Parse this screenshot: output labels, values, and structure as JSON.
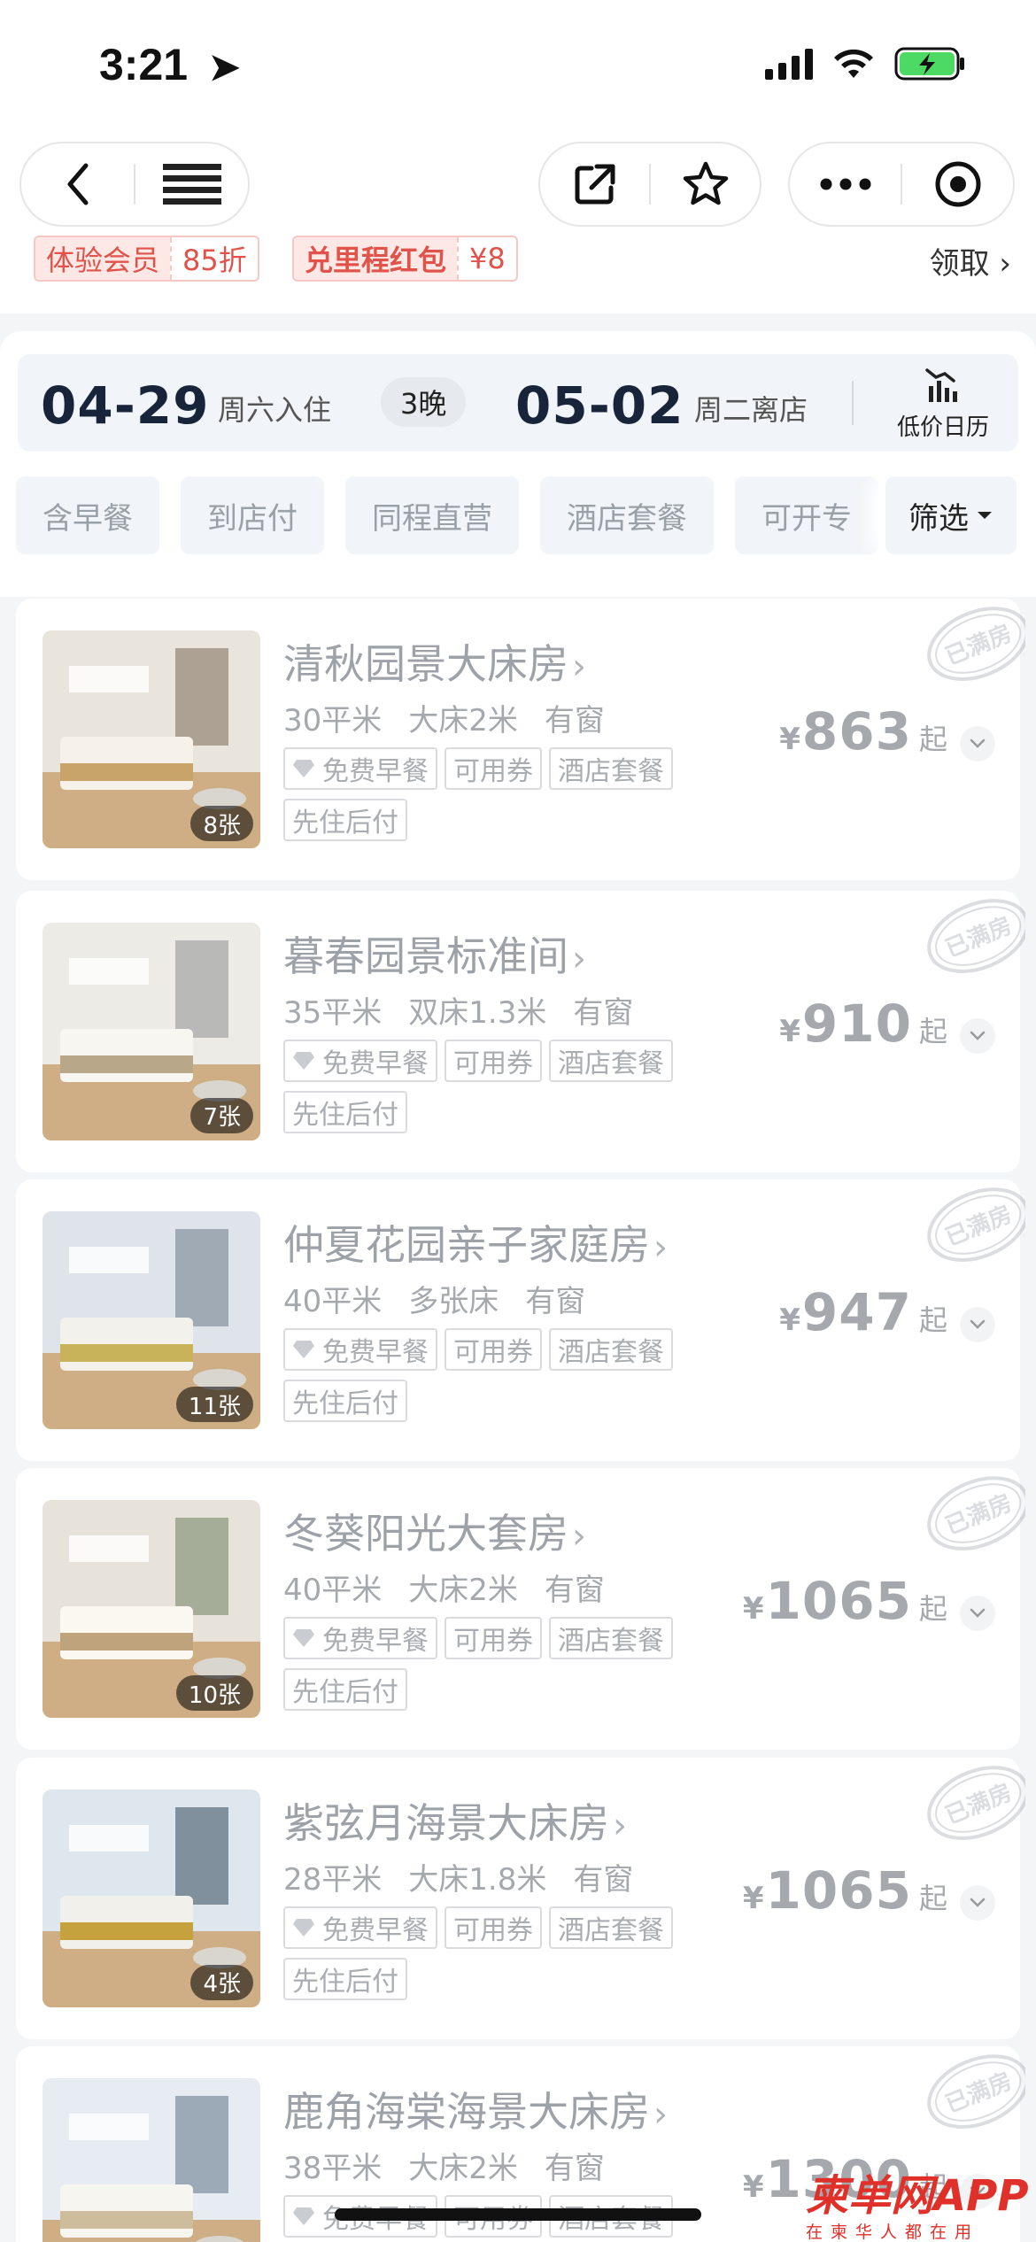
{
  "status_bar": {
    "time": "3:21"
  },
  "promo": {
    "tag1_left": "体验会员",
    "tag1_right": "85折",
    "tag2_left": "兑里程红包",
    "tag2_right": "¥8",
    "claim": "领取 ›"
  },
  "dates": {
    "checkin_date": "04-29",
    "checkin_label": "周六入住",
    "nights": "3晚",
    "checkout_date": "05-02",
    "checkout_label": "周二离店",
    "calendar_label": "低价日历"
  },
  "filters": {
    "chips": [
      "含早餐",
      "到店付",
      "同程直营",
      "酒店套餐",
      "可开专"
    ],
    "filter_button": "筛选"
  },
  "rooms": [
    {
      "name": "清秋园景大床房",
      "area": "30平米",
      "bed": "大床2米",
      "window": "有窗",
      "photos": "8张",
      "price": "863",
      "tags": [
        "免费早餐",
        "可用券",
        "酒店套餐"
      ],
      "tag2": "先住后付"
    },
    {
      "name": "暮春园景标准间",
      "area": "35平米",
      "bed": "双床1.3米",
      "window": "有窗",
      "photos": "7张",
      "price": "910",
      "tags": [
        "免费早餐",
        "可用券",
        "酒店套餐"
      ],
      "tag2": "先住后付"
    },
    {
      "name": "仲夏花园亲子家庭房",
      "area": "40平米",
      "bed": "多张床",
      "window": "有窗",
      "photos": "11张",
      "price": "947",
      "tags": [
        "免费早餐",
        "可用券",
        "酒店套餐"
      ],
      "tag2": "先住后付"
    },
    {
      "name": "冬葵阳光大套房",
      "area": "40平米",
      "bed": "大床2米",
      "window": "有窗",
      "photos": "10张",
      "price": "1065",
      "tags": [
        "免费早餐",
        "可用券",
        "酒店套餐"
      ],
      "tag2": "先住后付"
    },
    {
      "name": "紫弦月海景大床房",
      "area": "28平米",
      "bed": "大床1.8米",
      "window": "有窗",
      "photos": "4张",
      "price": "1065",
      "tags": [
        "免费早餐",
        "可用券",
        "酒店套餐"
      ],
      "tag2": "先住后付"
    },
    {
      "name": "鹿角海棠海景大床房",
      "area": "38平米",
      "bed": "大床2米",
      "window": "有窗",
      "photos": "",
      "price": "1300",
      "tags": [
        "免费早餐",
        "可用券",
        "酒店套餐"
      ],
      "tag2": ""
    }
  ],
  "labels": {
    "yen": "¥",
    "qi": "起",
    "sold_out": "已满房"
  },
  "watermark": {
    "main": "柬单网APP",
    "sub": "在柬华人都在用"
  },
  "colors": {
    "accent_red": "#e0534a",
    "date_text": "#18243a",
    "muted_text": "#a5a9ae",
    "chip_bg": "#f1f4f8"
  }
}
